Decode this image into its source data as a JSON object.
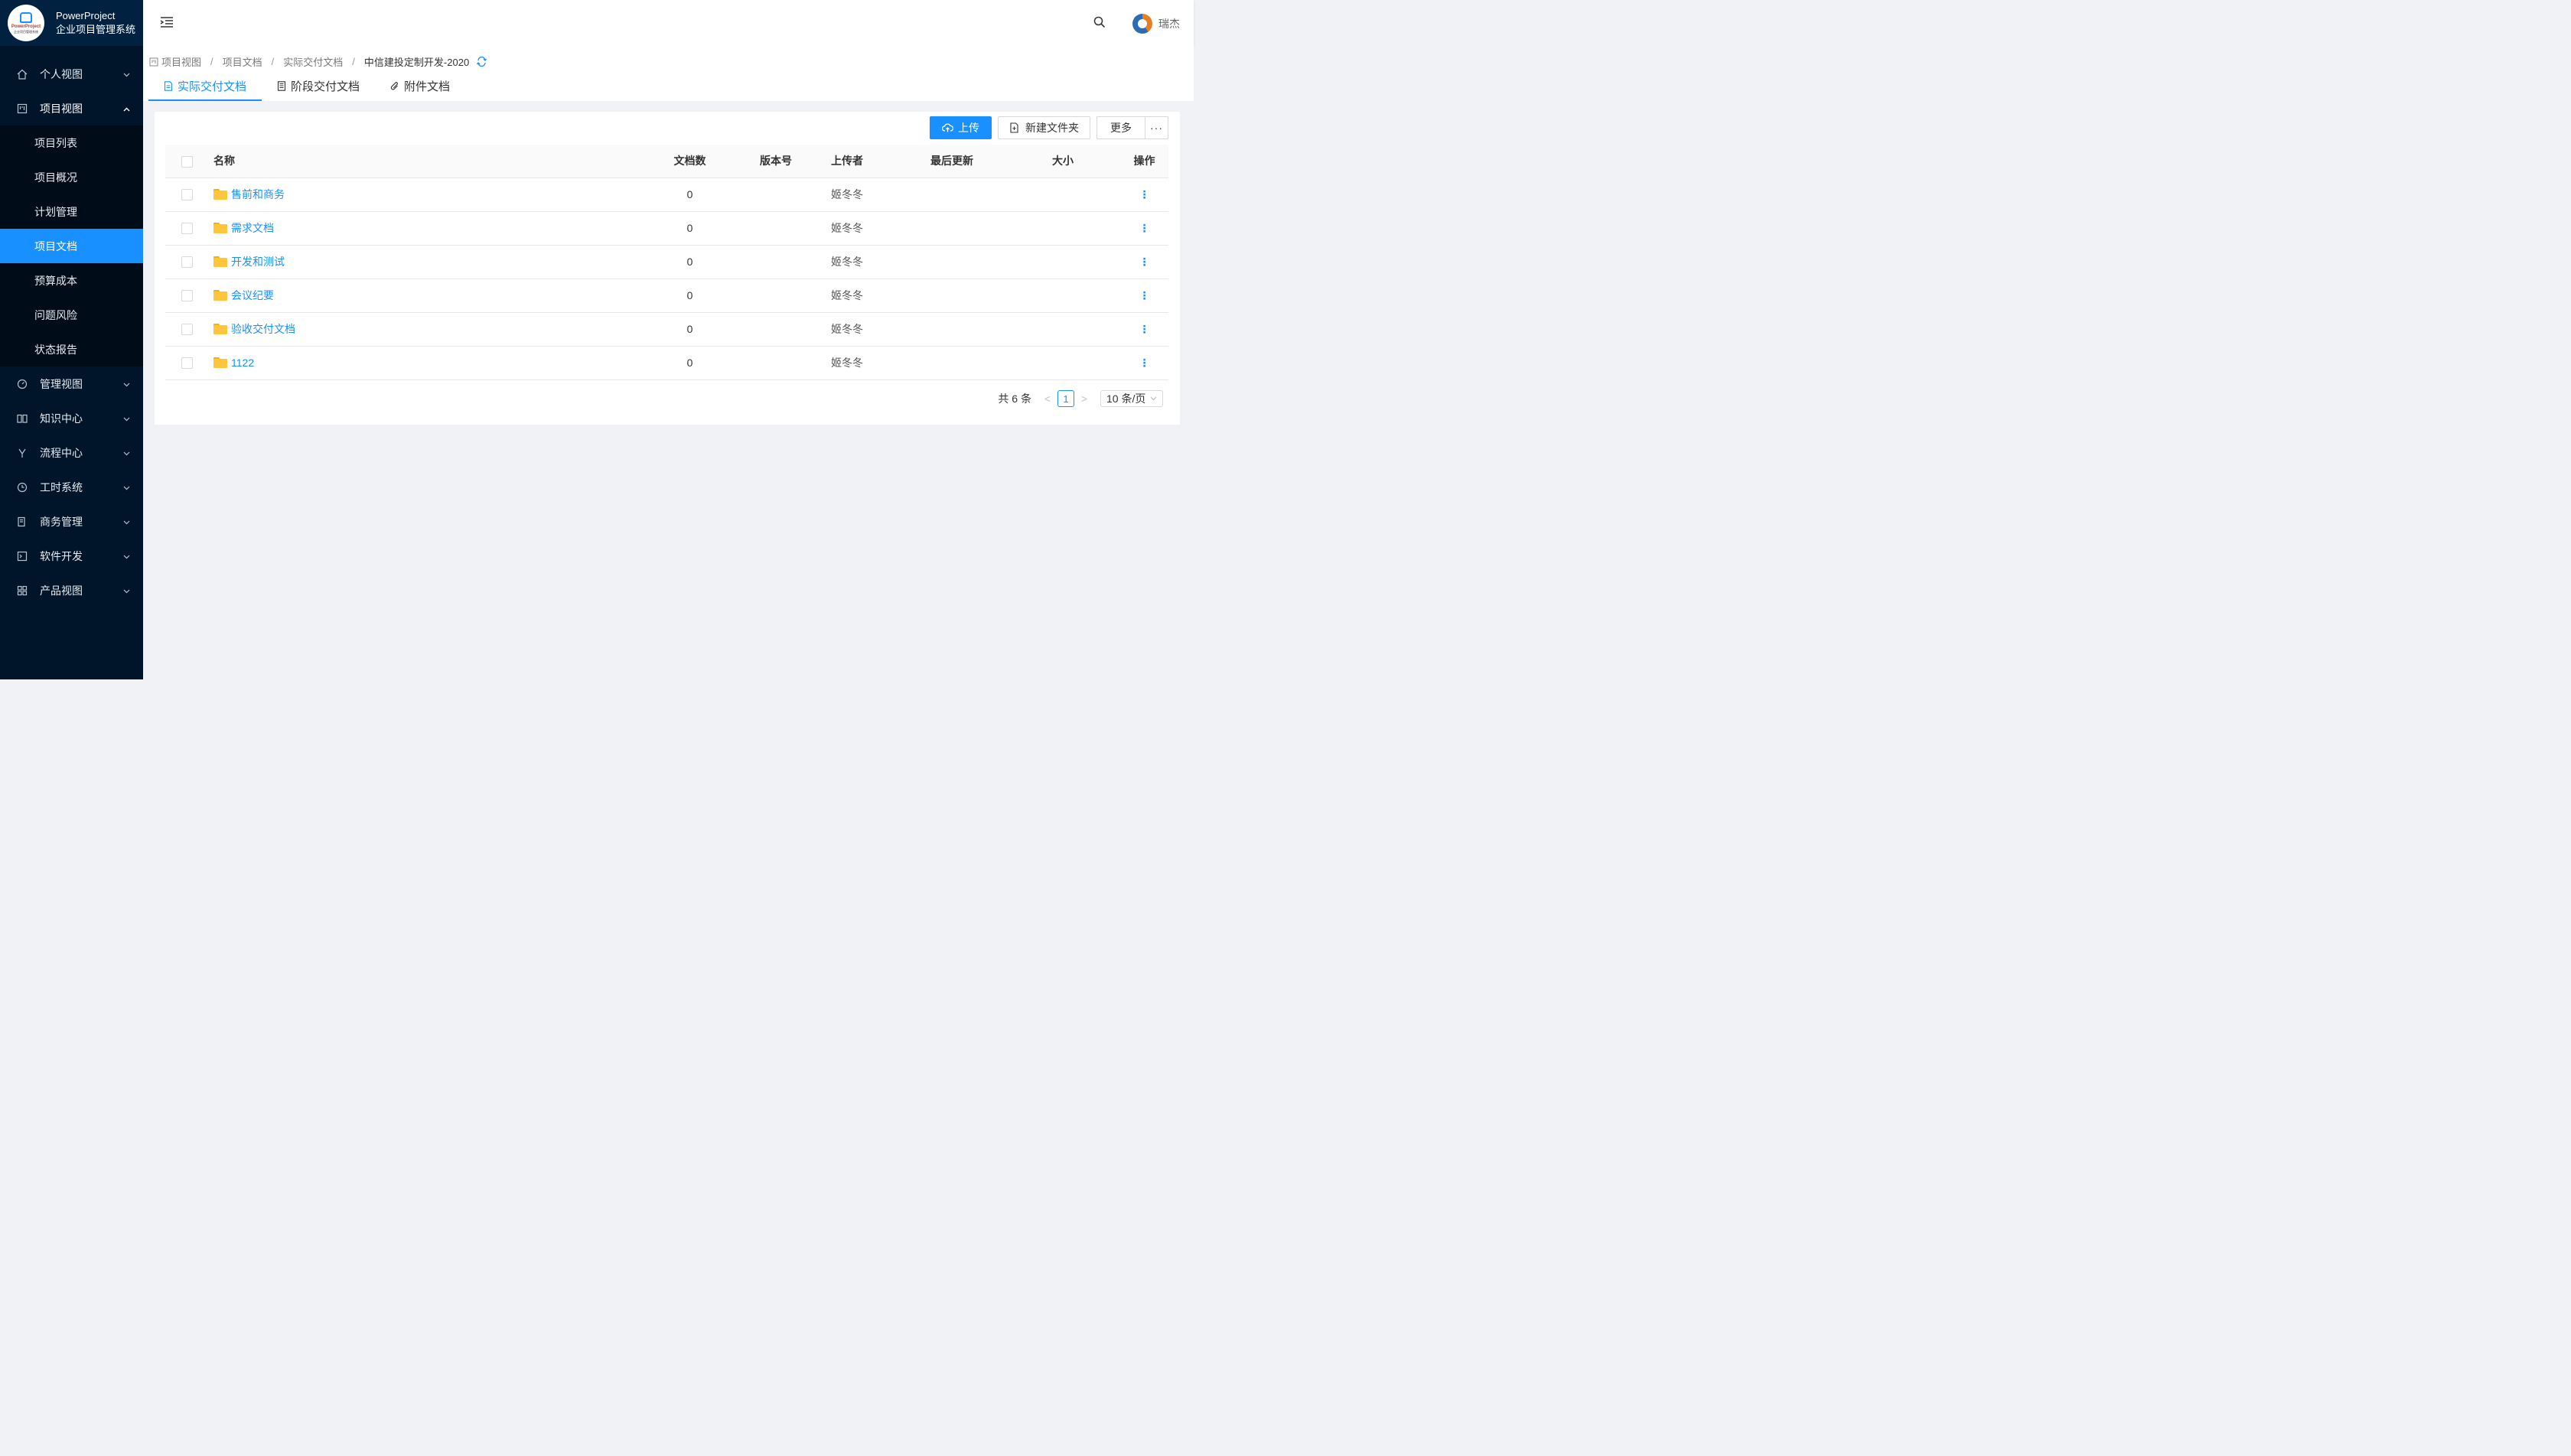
{
  "app": {
    "logo_word": "PowerProject",
    "logo_sub": "企业项目管理系统",
    "title_line1": "PowerProject",
    "title_line2": "企业项目管理系统"
  },
  "header": {
    "user_name": "瑞杰"
  },
  "sidebar": {
    "items": [
      {
        "label": "个人视图",
        "icon": "home-icon"
      },
      {
        "label": "项目视图",
        "icon": "project-icon",
        "expanded": true
      },
      {
        "label": "管理视图",
        "icon": "dashboard-icon"
      },
      {
        "label": "知识中心",
        "icon": "book-icon"
      },
      {
        "label": "流程中心",
        "icon": "flow-icon"
      },
      {
        "label": "工时系统",
        "icon": "clock-icon"
      },
      {
        "label": "商务管理",
        "icon": "contract-icon"
      },
      {
        "label": "软件开发",
        "icon": "code-icon"
      },
      {
        "label": "产品视图",
        "icon": "apps-icon"
      }
    ],
    "project_sub": [
      {
        "label": "项目列表"
      },
      {
        "label": "项目概况"
      },
      {
        "label": "计划管理"
      },
      {
        "label": "项目文档",
        "active": true
      },
      {
        "label": "预算成本"
      },
      {
        "label": "问题风险"
      },
      {
        "label": "状态报告"
      }
    ]
  },
  "breadcrumb": {
    "items": [
      "项目视图",
      "项目文档",
      "实际交付文档",
      "中信建投定制开发-2020"
    ],
    "separator": "/"
  },
  "tabs": [
    {
      "label": "实际交付文档",
      "active": true,
      "icon": "file-icon"
    },
    {
      "label": "阶段交付文档",
      "icon": "file-list-icon"
    },
    {
      "label": "附件文档",
      "icon": "paperclip-icon"
    }
  ],
  "toolbar": {
    "upload_label": "上传",
    "new_folder_label": "新建文件夹",
    "more_label": "更多",
    "dots_label": "···"
  },
  "table": {
    "headers": {
      "name": "名称",
      "doc_count": "文档数",
      "version": "版本号",
      "uploader": "上传者",
      "updated": "最后更新",
      "size": "大小",
      "ops": "操作"
    },
    "rows": [
      {
        "name": "售前和商务",
        "doc_count": "0",
        "version": "",
        "uploader": "姬冬冬",
        "updated": "",
        "size": "",
        "op": "⋮"
      },
      {
        "name": "需求文档",
        "doc_count": "0",
        "version": "",
        "uploader": "姬冬冬",
        "updated": "",
        "size": "",
        "op": "⋮"
      },
      {
        "name": "开发和测试",
        "doc_count": "0",
        "version": "",
        "uploader": "姬冬冬",
        "updated": "",
        "size": "",
        "op": "⋮"
      },
      {
        "name": "会议纪要",
        "doc_count": "0",
        "version": "",
        "uploader": "姬冬冬",
        "updated": "",
        "size": "",
        "op": "⋮"
      },
      {
        "name": "验收交付文档",
        "doc_count": "0",
        "version": "",
        "uploader": "姬冬冬",
        "updated": "",
        "size": "",
        "op": "⋮"
      },
      {
        "name": "1122",
        "doc_count": "0",
        "version": "",
        "uploader": "姬冬冬",
        "updated": "",
        "size": "",
        "op": "⋮"
      }
    ]
  },
  "pagination": {
    "total_text": "共 6 条",
    "current_page": "1",
    "prev": "<",
    "next": ">",
    "page_size": "10 条/页"
  },
  "colors": {
    "primary": "#1890ff",
    "sidebar_bg": "#001529",
    "folder": "#ffc53d"
  }
}
